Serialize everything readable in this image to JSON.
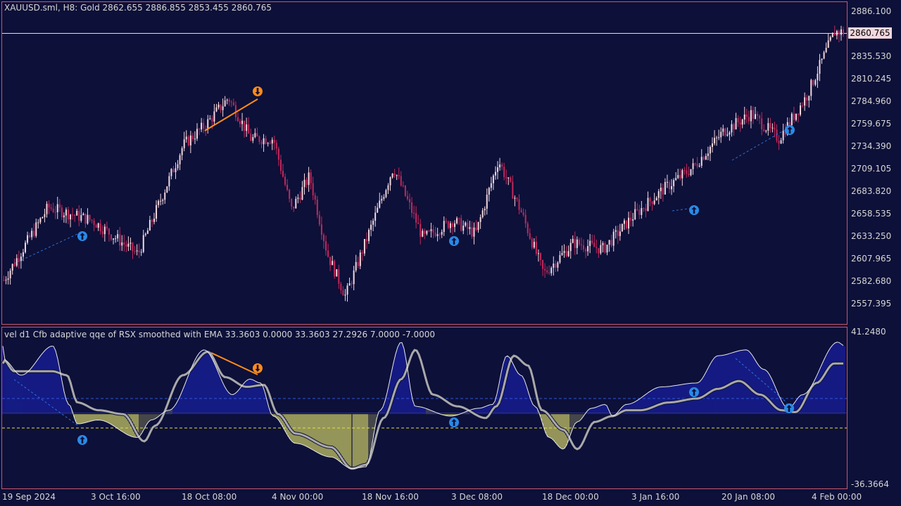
{
  "main_chart": {
    "header": "XAUUSD.sml, H8:  Gold  2862.655 2886.855 2853.455 2860.765",
    "current_price": "2860.765",
    "price_ticks": [
      "2886.100",
      "2835.530",
      "2810.245",
      "2784.960",
      "2759.675",
      "2734.390",
      "2709.105",
      "2683.820",
      "2658.535",
      "2633.250",
      "2607.965",
      "2582.680",
      "2557.395"
    ]
  },
  "indicator": {
    "header": "vel d1 Cfb adaptive qqe of RSX smoothed with EMA 33.3603 0.0000 33.3603 27.2926 7.0000 -7.0000",
    "max_label": "41.2480",
    "min_label": "-36.3664"
  },
  "time_axis": [
    "19 Sep 2024",
    "3 Oct 16:00",
    "18 Oct 08:00",
    "4 Nov 00:00",
    "18 Nov 16:00",
    "3 Dec 08:00",
    "18 Dec 00:00",
    "3 Jan 16:00",
    "20 Jan 08:00",
    "4 Feb 00:00"
  ],
  "colors": {
    "background": "#0d1038",
    "border": "#c8566f",
    "bull_candle": "#f2d7de",
    "bear_candle": "#c2285a",
    "histogram_positive": "#1a23b4",
    "histogram_negative": "#eeee70",
    "signal_line": "#a9a9a9",
    "divergence": "#ff8c1a",
    "arrow_up": "#2a8ae6"
  },
  "chart_data": [
    {
      "type": "candlestick",
      "title": "XAUUSD.sml, H8: Gold",
      "ohlc_last": {
        "open": 2862.655,
        "high": 2886.855,
        "low": 2853.455,
        "close": 2860.765
      },
      "x_range": [
        "19 Sep 2024",
        "4 Feb 00:00"
      ],
      "ylim": [
        2545,
        2895
      ],
      "approx_close_path": [
        [
          "19 Sep 2024",
          2583
        ],
        [
          "26 Sep",
          2665
        ],
        [
          "3 Oct 16:00",
          2650
        ],
        [
          "8 Oct",
          2612
        ],
        [
          "18 Oct 08:00",
          2735
        ],
        [
          "23 Oct",
          2758
        ],
        [
          "30 Oct",
          2788
        ],
        [
          "31 Oct",
          2742
        ],
        [
          "4 Nov 00:00",
          2742
        ],
        [
          "6 Nov",
          2662
        ],
        [
          "8 Nov",
          2700
        ],
        [
          "12 Nov",
          2612
        ],
        [
          "15 Nov",
          2565
        ],
        [
          "18 Nov 16:00",
          2620
        ],
        [
          "25 Nov",
          2710
        ],
        [
          "26 Nov",
          2630
        ],
        [
          "3 Dec 08:00",
          2650
        ],
        [
          "6 Dec",
          2635
        ],
        [
          "12 Dec",
          2718
        ],
        [
          "14 Dec",
          2660
        ],
        [
          "18 Dec 00:00",
          2590
        ],
        [
          "23 Dec",
          2625
        ],
        [
          "27 Dec",
          2618
        ],
        [
          "3 Jan 16:00",
          2655
        ],
        [
          "10 Jan",
          2685
        ],
        [
          "15 Jan",
          2710
        ],
        [
          "20 Jan 08:00",
          2750
        ],
        [
          "23 Jan",
          2770
        ],
        [
          "27 Jan",
          2742
        ],
        [
          "30 Jan",
          2790
        ],
        [
          "4 Feb 00:00",
          2862
        ]
      ]
    },
    {
      "type": "area",
      "title": "vel d1 Cfb adaptive qqe of RSX smoothed with EMA",
      "values": {
        "value": 33.3603,
        "zero": 0.0,
        "qqe": 33.3603,
        "signal": 27.2926,
        "upper_level": 7.0,
        "lower_level": -7.0
      },
      "ylim": [
        -36.3664,
        41.248
      ]
    }
  ]
}
